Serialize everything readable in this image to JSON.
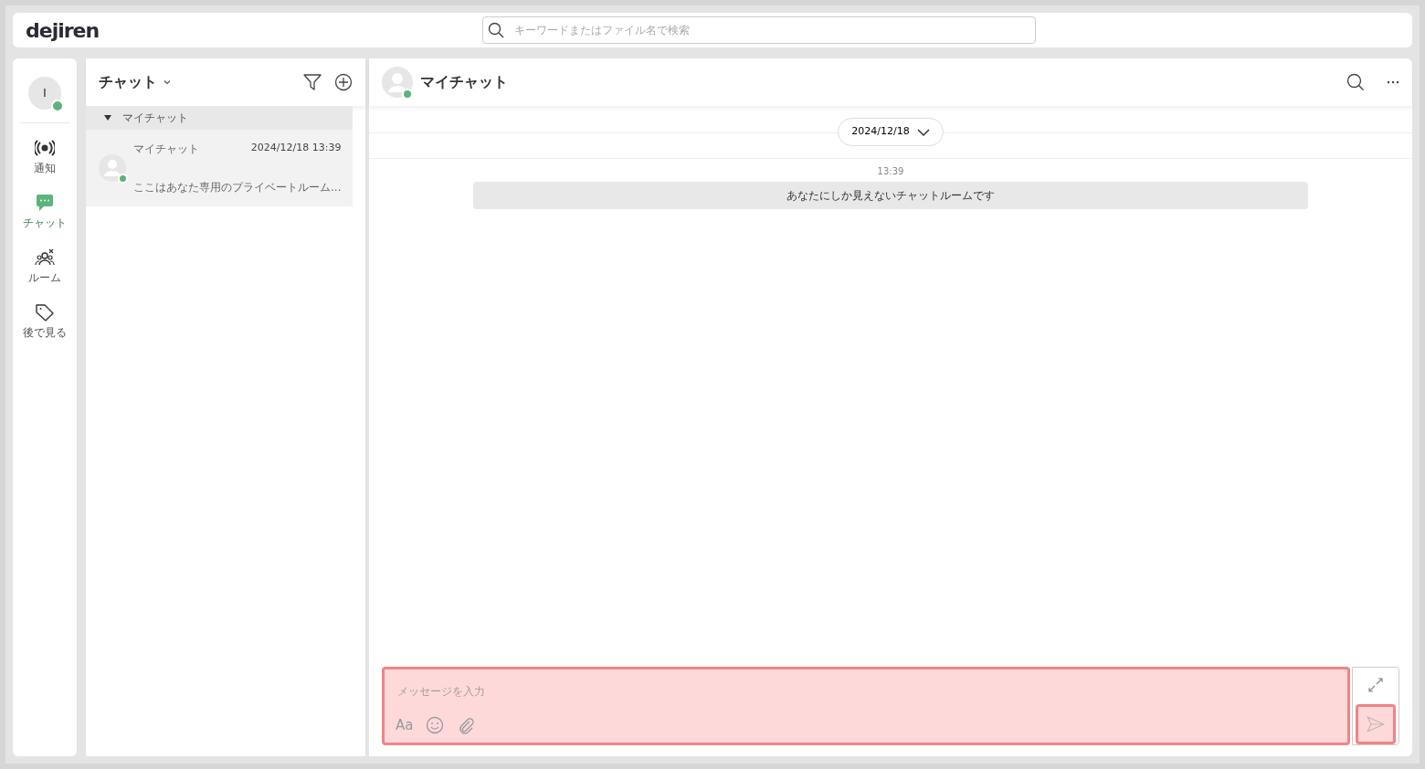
{
  "app": {
    "logo": "dejiren",
    "search": {
      "placeholder": "キーワードまたはファイル名で検索"
    }
  },
  "user": {
    "initial": "I",
    "online": true
  },
  "nav": [
    {
      "label": "通知",
      "selected": false
    },
    {
      "label": "チャット",
      "selected": true
    },
    {
      "label": "ルーム",
      "selected": false
    },
    {
      "label": "後で見る",
      "selected": false
    }
  ],
  "chat_list": {
    "title": "チャット",
    "groups": [
      {
        "label": "マイチャット",
        "expanded": true,
        "items": [
          {
            "name": "マイチャット",
            "time": "2024/12/18 13:39",
            "preview": "ここはあなた専用のプライベートルーム...",
            "online": true,
            "selected": true
          }
        ]
      }
    ]
  },
  "conversation": {
    "title": "マイチャット",
    "online": true,
    "date": "2024/12/18",
    "messages": [
      {
        "kind": "system",
        "time": "13:39",
        "text": "あなたにしか見えないチャットルームです"
      }
    ]
  },
  "composer": {
    "placeholder": "メッセージを入力",
    "format_label": "Aa",
    "highlighted": true
  },
  "send": {
    "highlighted": true
  }
}
